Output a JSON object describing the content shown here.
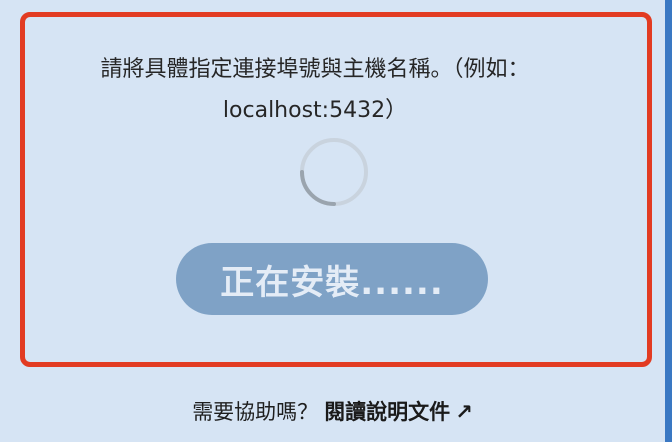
{
  "panel": {
    "instruction_line1": "請將具體指定連接埠號與主機名稱。（例如：",
    "instruction_line2": "localhost:5432）",
    "install_button_label": "正在安裝......"
  },
  "help": {
    "prompt": "需要協助嗎？",
    "link_label": "閱讀說明文件",
    "link_arrow": "↗"
  },
  "colors": {
    "panel_background": "#d6e4f4",
    "highlight_border": "#e23b22",
    "button_background": "#7fa2c6",
    "button_text": "#e4ecf6",
    "right_edge": "#3a78c3"
  },
  "icons": {
    "spinner": "loading-spinner-icon",
    "external_link": "external-link-arrow-icon"
  }
}
